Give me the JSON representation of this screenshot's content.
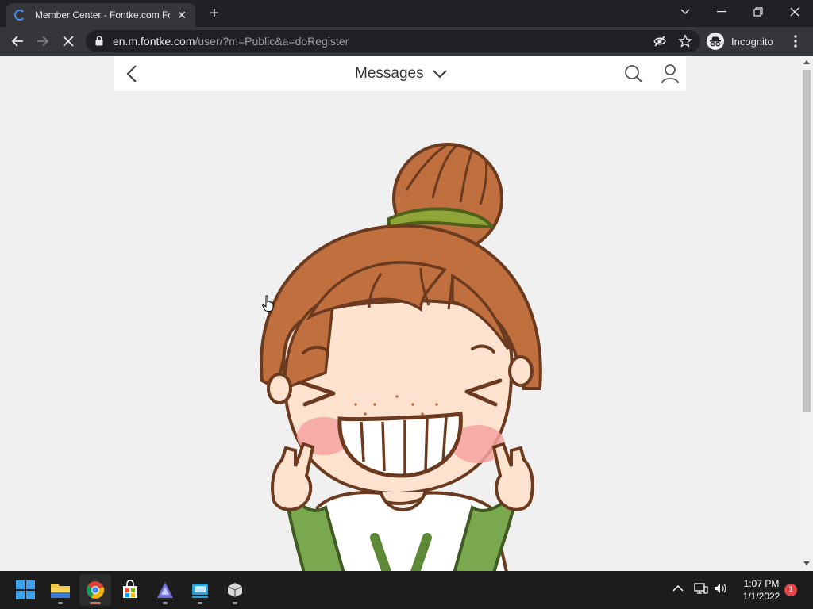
{
  "browser": {
    "tab_title": "Member Center - Fontke.com Fo",
    "url_host": "en.m.fontke.com",
    "url_path": "/user/?m=Public&a=doRegister",
    "incognito_label": "Incognito"
  },
  "site": {
    "header_title": "Messages"
  },
  "taskbar": {
    "time": "1:07 PM",
    "date": "1/1/2022",
    "notification_count": "1"
  },
  "colors": {
    "browser_dark": "#202124",
    "browser_toolbar": "#35363a",
    "page_bg": "#f0f0f0",
    "hair": "#c0703e",
    "hair_tie": "#8da637",
    "skin": "#fde2cf",
    "blush": "#f4a2a0",
    "shirt_green": "#7aa84e"
  }
}
